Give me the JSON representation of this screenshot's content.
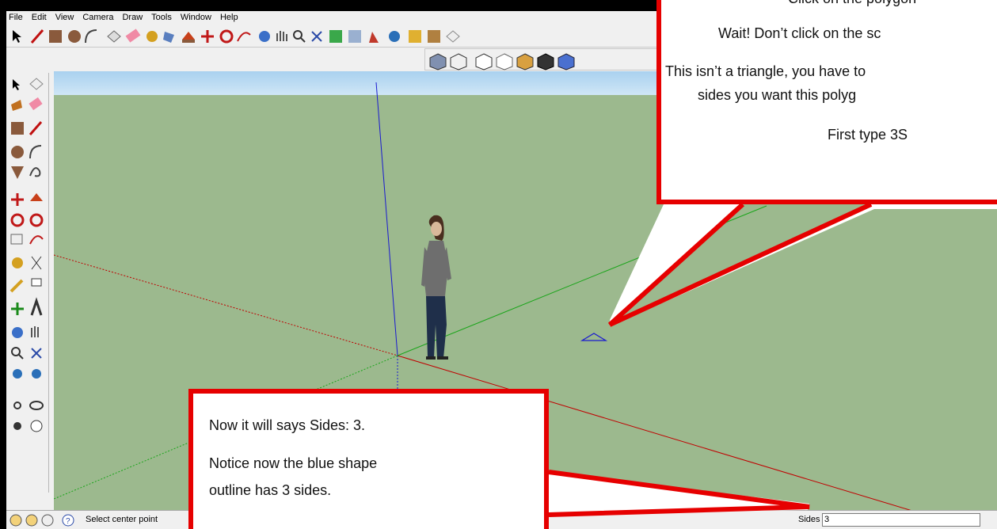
{
  "menu": [
    "File",
    "Edit",
    "View",
    "Camera",
    "Draw",
    "Tools",
    "Window",
    "Help"
  ],
  "status": {
    "hint": "Select center point",
    "measure_label": "Sides",
    "measure_value": "3"
  },
  "callout_top": {
    "line1": "Click on the polygon",
    "line2": "Wait! Don’t click on the sc",
    "line3": "This isn’t a triangle, you have to",
    "line4": "sides you want this polyg",
    "line5": "First type 3S"
  },
  "callout_bottom": {
    "line1": "Now it will says Sides: 3.",
    "line2": "Notice now the blue shape",
    "line3": "outline has 3 sides."
  },
  "colors": {
    "callout_border": "#e60000",
    "ground": "#9cb98e",
    "sky": "#cfe6f6",
    "axis_red": "#c00000",
    "axis_green": "#1aa51a",
    "axis_blue": "#1a1ad0"
  }
}
